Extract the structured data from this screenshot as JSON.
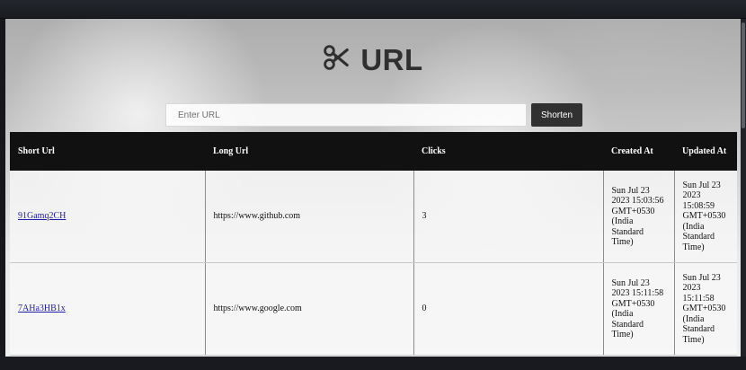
{
  "app": {
    "title": "URL",
    "icon": "scissors-icon"
  },
  "search": {
    "placeholder": "Enter URL",
    "value": "",
    "button_label": "Shorten"
  },
  "table": {
    "headers": {
      "short_url": "Short Url",
      "long_url": "Long Url",
      "clicks": "Clicks",
      "created_at": "Created At",
      "updated_at": "Updated At"
    },
    "rows": [
      {
        "short_url": "91Gamq2CH",
        "long_url": "https://www.github.com",
        "clicks": "3",
        "created_at": "Sun Jul 23 2023 15:03:56 GMT+0530 (India Standard Time)",
        "updated_at": "Sun Jul 23 2023 15:08:59 GMT+0530 (India Standard Time)"
      },
      {
        "short_url": "7AHa3HB1x",
        "long_url": "https://www.google.com",
        "clicks": "0",
        "created_at": "Sun Jul 23 2023 15:11:58 GMT+0530 (India Standard Time)",
        "updated_at": "Sun Jul 23 2023 15:11:58 GMT+0530 (India Standard Time)"
      }
    ]
  },
  "colors": {
    "table_header": "#111111",
    "button": "#313131",
    "link": "#1f1ca8"
  }
}
